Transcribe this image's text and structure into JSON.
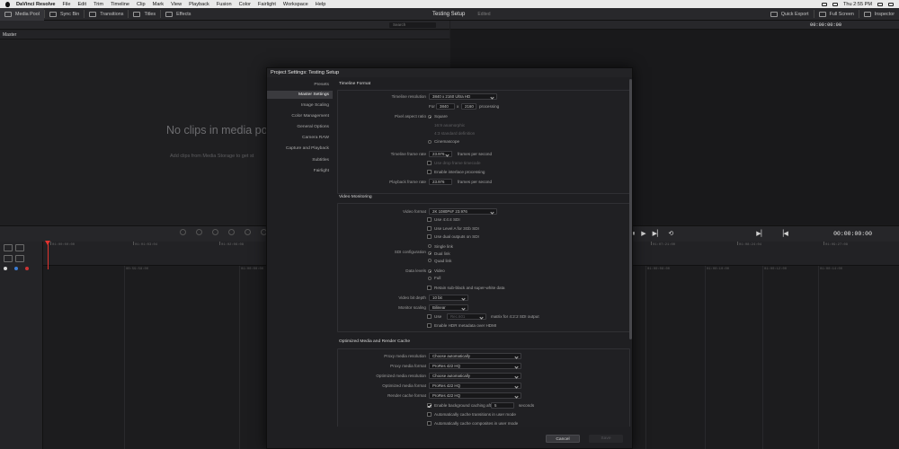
{
  "menubar": {
    "items": [
      "DaVinci Resolve",
      "File",
      "Edit",
      "Trim",
      "Timeline",
      "Clip",
      "Mark",
      "View",
      "Playback",
      "Fusion",
      "Color",
      "Fairlight",
      "Workspace",
      "Help"
    ],
    "clock": "Thu 2:55 PM"
  },
  "toolbar": {
    "media_pool": "Media Pool",
    "sync_bin": "Sync Bin",
    "transitions": "Transitions",
    "titles": "Titles",
    "effects": "Effects",
    "project_title": "Testing Setup",
    "edited": "Edited",
    "quick_export": "Quick Export",
    "full_screen": "Full Screen",
    "inspector": "Inspector"
  },
  "media_pool": {
    "search_placeholder": "Search",
    "bin": "Master",
    "empty_title": "No clips in media po",
    "empty_hint": "Add clips from Media Storage to get st"
  },
  "viewer": {
    "timecode": "00:00:00:00"
  },
  "timeline": {
    "record_timecode": "00:00:00:00",
    "ruler": [
      "01:00:00:00",
      "01:01:03:04",
      "01:02:06:08",
      "01:03:09:12",
      "01:04:12:16",
      "01:05:15:20",
      "01:06:18:20",
      "01:07:21:00",
      "01:08:24:04",
      "01:09:27:08"
    ],
    "track_ruler": [
      "00:59:58:00",
      "01:00:00:00",
      "01:00:02:00",
      "01:00:04:00",
      "01:00:06:00",
      "01:00:08:00",
      "01:00:10:00",
      "01:00:12:00",
      "01:00:14:00"
    ]
  },
  "project_settings": {
    "title": "Project Settings:  Testing Setup",
    "nav": [
      "Presets",
      "Master Settings",
      "Image Scaling",
      "Color Management",
      "General Options",
      "Camera RAW",
      "Capture and Playback",
      "Subtitles",
      "Fairlight"
    ],
    "active_nav": "Master Settings",
    "timeline_format": {
      "section": "Timeline Format",
      "resolution_label": "Timeline resolution",
      "resolution_value": "3840 x 2160 Ultra HD",
      "for_label": "For",
      "width": "3840",
      "x": "x",
      "height": "2160",
      "processing": "processing",
      "pixel_aspect_label": "Pixel aspect ratio",
      "pixel_aspect_options": [
        "Square",
        "16:9 anamorphic",
        "4:3 standard definition",
        "Cinemascope"
      ],
      "framerate_label": "Timeline frame rate",
      "framerate_value": "23.976",
      "fps_suffix": "frames per second",
      "drop_frame": "Use drop frame timecode",
      "interlace": "Enable interlace processing",
      "playback_label": "Playback frame rate",
      "playback_value": "23.976",
      "playback_suffix": "frames per second"
    },
    "video_monitoring": {
      "section": "Video Monitoring",
      "format_label": "Video format",
      "format_value": "2K 1080PsF 23.976",
      "use_444": "Use 4:4:4 SDI",
      "use_level_a": "Use Level A for 3Gb SDI",
      "use_dual": "Use dual outputs on SDI",
      "sdi_label": "SDI configuration",
      "sdi_options": [
        "Single link",
        "Dual link",
        "Quad link"
      ],
      "data_levels_label": "Data levels",
      "data_levels_options": [
        "Video",
        "Full"
      ],
      "retain_sub": "Retain sub-black and super-white data",
      "bit_depth_label": "Video bit depth",
      "bit_depth_value": "10 bit",
      "scaling_label": "Monitor scaling",
      "scaling_value": "Bilinear",
      "use_label": "Use",
      "matrix_value": "Rec.601",
      "matrix_suffix": "matrix for 4:2:2 SDI output",
      "hdr_metadata": "Enable HDR metadata over HDMI"
    },
    "optimized_media": {
      "section": "Optimized Media and Render Cache",
      "proxy_res_label": "Proxy media resolution",
      "proxy_res_value": "Choose automatically",
      "proxy_fmt_label": "Proxy media format",
      "proxy_fmt_value": "ProRes 422 HQ",
      "opt_res_label": "Optimized media resolution",
      "opt_res_value": "Choose automatically",
      "opt_fmt_label": "Optimized media format",
      "opt_fmt_value": "ProRes 422 HQ",
      "cache_fmt_label": "Render cache format",
      "cache_fmt_value": "ProRes 422 HQ",
      "bg_cache_label": "Enable background caching after",
      "bg_cache_value": "5",
      "bg_cache_suffix": "seconds",
      "auto_transitions": "Automatically cache transitions in user mode",
      "auto_composites": "Automatically cache composites in user mode"
    },
    "footer": {
      "cancel": "Cancel",
      "save": "Save"
    }
  },
  "colors": {
    "accent_red": "#e2332e",
    "panel_bg": "#1f1f22",
    "modal_border": "#0e0e0e"
  }
}
